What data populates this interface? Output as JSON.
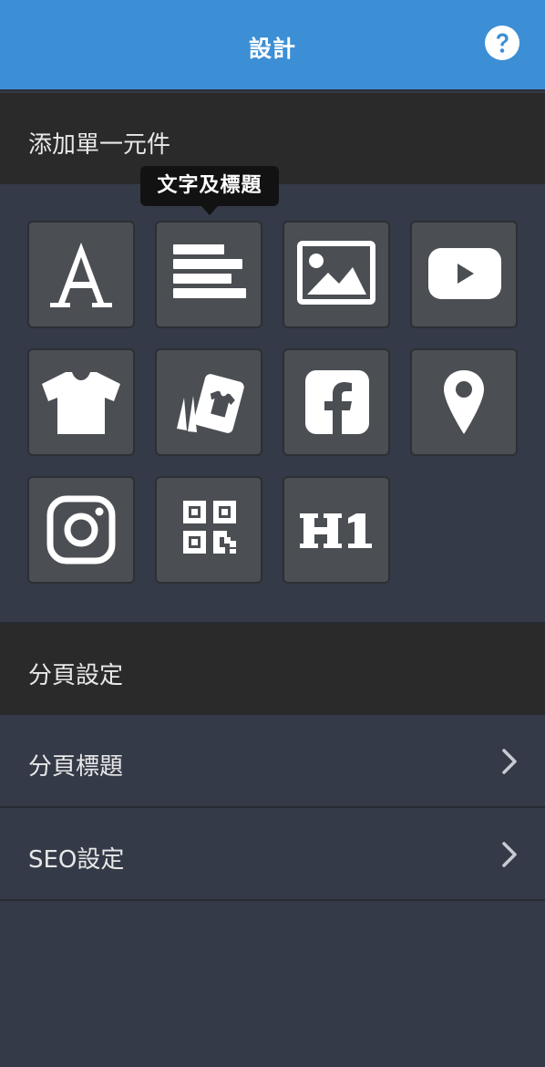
{
  "header": {
    "title": "設計",
    "help_icon": "question-circle-icon",
    "background": "#3c8fd5"
  },
  "add_element": {
    "title": "添加單一元件",
    "tooltip": "文字及標題",
    "widgets": [
      {
        "icon": "font-letter-a-icon"
      },
      {
        "icon": "text-lines-icon"
      },
      {
        "icon": "image-icon"
      },
      {
        "icon": "youtube-icon"
      },
      {
        "icon": "tshirt-icon"
      },
      {
        "icon": "product-cards-icon"
      },
      {
        "icon": "facebook-icon"
      },
      {
        "icon": "map-pin-icon"
      },
      {
        "icon": "instagram-icon"
      },
      {
        "icon": "qr-code-icon"
      },
      {
        "icon": "heading-h1-icon"
      }
    ]
  },
  "page_settings": {
    "title": "分頁設定",
    "items": [
      {
        "label": "分頁標題",
        "icon": "chevron-right-icon"
      },
      {
        "label": "SEO設定",
        "icon": "chevron-right-icon"
      }
    ]
  }
}
